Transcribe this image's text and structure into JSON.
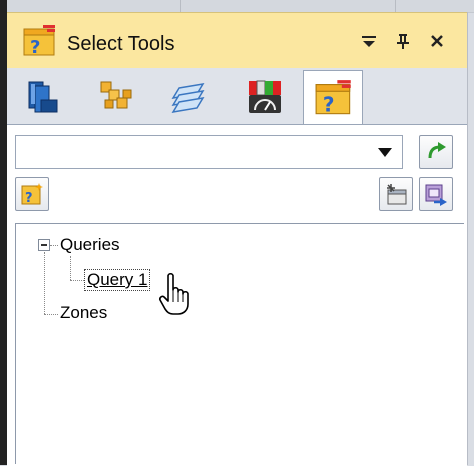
{
  "panel": {
    "title": "Select Tools",
    "title_icon": "select-tools-query-icon",
    "controls": [
      "dropdown-menu-icon",
      "pin-icon",
      "close-icon"
    ]
  },
  "tabs": [
    {
      "icon": "parts-stack-icon",
      "active": false
    },
    {
      "icon": "assembly-blocks-icon",
      "active": false
    },
    {
      "icon": "layers-icon",
      "active": false
    },
    {
      "icon": "gauge-icon",
      "active": false
    },
    {
      "icon": "query-icon",
      "active": true
    }
  ],
  "query_combo": {
    "value": "",
    "icon": "dropdown-arrow-icon"
  },
  "buttons": {
    "run": "green-arrow-run-icon",
    "new_query": "new-query-icon",
    "properties": "properties-icon",
    "select_to": "select-to-icon"
  },
  "tree": {
    "nodes": [
      {
        "label": "Queries",
        "level": 0,
        "expanded": true
      },
      {
        "label": "Query 1",
        "level": 1,
        "selected": true
      },
      {
        "label": "Zones",
        "level": 0
      }
    ]
  },
  "colors": {
    "titlebar": "#fbe7a0",
    "panel": "#dfe3ea",
    "border": "#9aa6b8"
  }
}
